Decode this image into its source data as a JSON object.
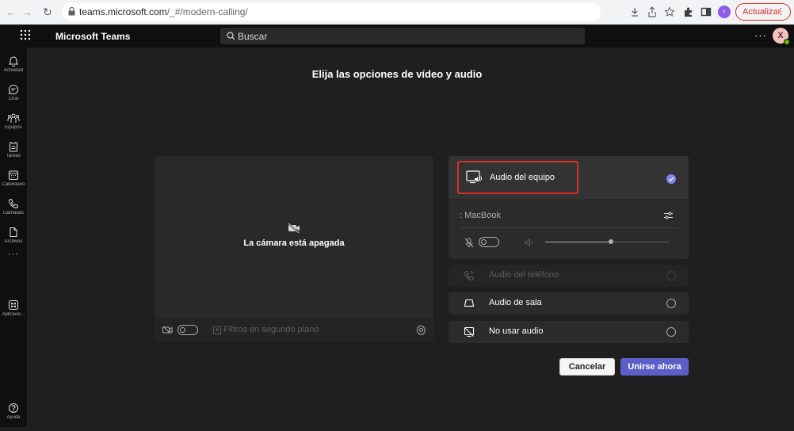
{
  "browser": {
    "url_domain": "teams.microsoft.com",
    "url_path": "/_#/modern-calling/",
    "profile_initial": "r",
    "update_label": "Actualizar",
    "update_menu": "⋮"
  },
  "topbar": {
    "app_name": "Microsoft Teams",
    "search_placeholder": "Buscar",
    "more": "···",
    "avatar_initial": "X"
  },
  "sidebar": {
    "items": [
      {
        "label": "Actividad",
        "icon": "bell-icon"
      },
      {
        "label": "Chat",
        "icon": "chat-icon"
      },
      {
        "label": "Equipos",
        "icon": "teams-icon"
      },
      {
        "label": "Tareas",
        "icon": "tasks-icon"
      },
      {
        "label": "Calendario",
        "icon": "calendar-icon"
      },
      {
        "label": "Llamadas",
        "icon": "phone-icon"
      },
      {
        "label": "Archivos",
        "icon": "file-icon"
      },
      {
        "label": "Aplicacio...",
        "icon": "apps-icon"
      },
      {
        "label": "Ayuda",
        "icon": "help-icon"
      }
    ],
    "more": "···"
  },
  "main": {
    "heading": "Elija las opciones de vídeo y audio",
    "camera_off": "La cámara está apagada",
    "bg_filters": "Filtros en segundo plano"
  },
  "audio": {
    "pc_audio": "Audio del equipo",
    "device_name": ": MacBook",
    "volume_level": 0.53,
    "options": {
      "phone": "Audio del teléfono",
      "room": "Audio de sala",
      "none": "No usar audio"
    }
  },
  "actions": {
    "cancel": "Cancelar",
    "join": "Unirse ahora"
  },
  "colors": {
    "accent": "#5b5fc7",
    "check": "#7f85f5",
    "highlight": "#d8311f"
  }
}
